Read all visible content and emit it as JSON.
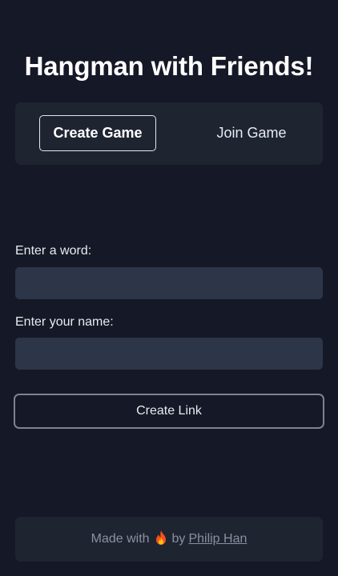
{
  "title": "Hangman with Friends!",
  "tabs": {
    "create": "Create Game",
    "join": "Join Game"
  },
  "form": {
    "word_label": "Enter a word:",
    "word_value": "",
    "name_label": "Enter your name:",
    "name_value": "",
    "submit_label": "Create Link"
  },
  "footer": {
    "made_with": "Made with",
    "icon": "fire-icon",
    "by": "by",
    "author": "Philip Han"
  },
  "colors": {
    "background": "#151826",
    "panel": "#1f2431",
    "input": "#2d3548",
    "text": "#e8eaf0",
    "muted": "#8a90a0"
  }
}
